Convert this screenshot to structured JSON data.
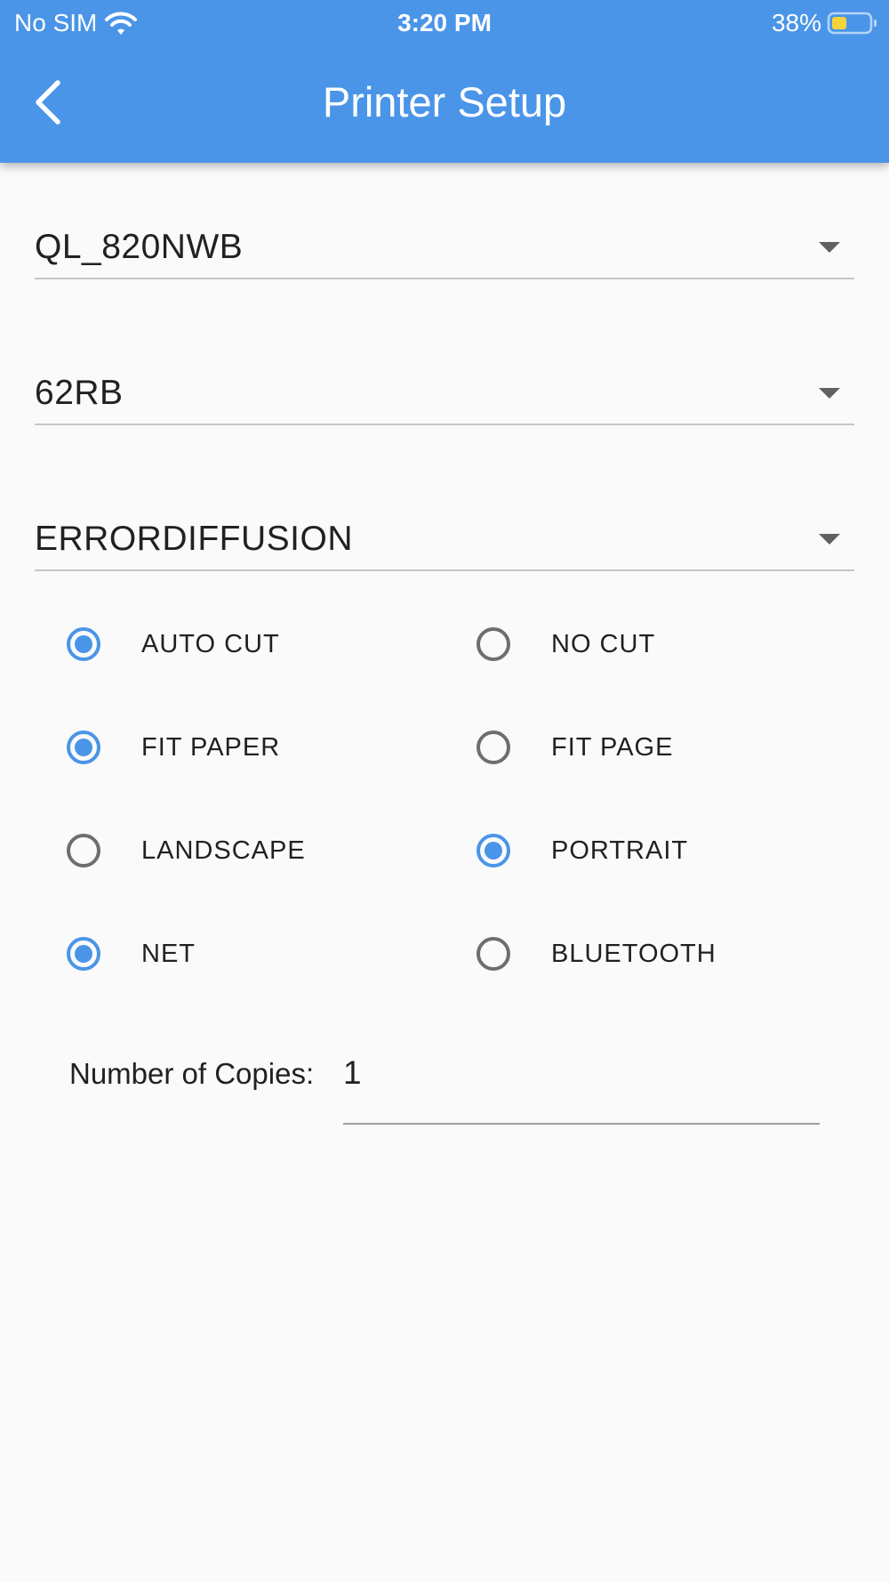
{
  "status_bar": {
    "carrier": "No SIM",
    "time": "3:20 PM",
    "battery": "38%",
    "battery_level": 0.38,
    "icons": [
      "wifi-icon",
      "battery-icon"
    ]
  },
  "appbar": {
    "title": "Printer Setup",
    "back_icon": "chevron-left-icon",
    "color": "#4a95e8"
  },
  "dropdowns": {
    "printer_model": "QL_820NWB",
    "label_size": "62RB",
    "halftone": "ERRORDIFFUSION"
  },
  "options": {
    "cut": {
      "auto_cut": {
        "label": "AUTO CUT",
        "selected": true
      },
      "no_cut": {
        "label": "NO CUT",
        "selected": false
      }
    },
    "scale": {
      "fit_paper": {
        "label": "FIT PAPER",
        "selected": true
      },
      "fit_page": {
        "label": "FIT PAGE",
        "selected": false
      }
    },
    "orientation": {
      "landscape": {
        "label": "LANDSCAPE",
        "selected": false
      },
      "portrait": {
        "label": "PORTRAIT",
        "selected": true
      }
    },
    "connection": {
      "net": {
        "label": "NET",
        "selected": true
      },
      "bluetooth": {
        "label": "BLUETOOTH",
        "selected": false
      }
    }
  },
  "copies": {
    "label": "Number of Copies:",
    "value": "1"
  },
  "colors": {
    "accent": "#4a95e8",
    "radio_unselected": "#6e6e6e",
    "background": "#fafafa"
  }
}
